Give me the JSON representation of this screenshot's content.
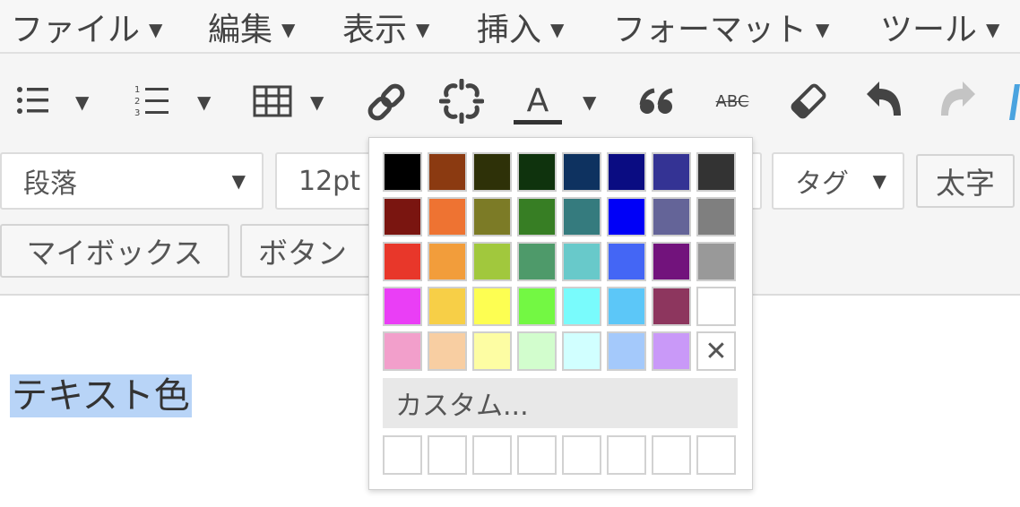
{
  "menubar": {
    "items": [
      {
        "label": "ファイル",
        "caret": "▼"
      },
      {
        "label": "編集",
        "caret": "▼"
      },
      {
        "label": "表示",
        "caret": "▼"
      },
      {
        "label": "挿入",
        "caret": "▼"
      },
      {
        "label": "フォーマット",
        "caret": "▼"
      },
      {
        "label": "ツール",
        "caret": "▼"
      }
    ]
  },
  "toolbar1": {
    "icons": [
      "bullet-list-icon",
      "numbered-list-icon",
      "table-icon",
      "link-icon",
      "unlink-icon",
      "text-color-icon",
      "blockquote-icon",
      "strikethrough-icon",
      "eraser-icon",
      "undo-icon",
      "redo-icon"
    ],
    "text_color_letter": "A",
    "strikethrough_text": "ABC",
    "caret": "▼"
  },
  "toolbar2": {
    "format_select": "段落",
    "font_size_select": "12pt",
    "tag_button": "タグ",
    "bold_button": "太字",
    "caret": "▼"
  },
  "toolbar3": {
    "mybox_button": "マイボックス",
    "button_button": "ボタン"
  },
  "content": {
    "selected_text": "テキスト色"
  },
  "color_picker": {
    "swatches": [
      [
        "#000000",
        "#8B3A11",
        "#2E3108",
        "#0F330D",
        "#0E3260",
        "#0A0C82",
        "#343394",
        "#333333"
      ],
      [
        "#7A1510",
        "#EE7332",
        "#7C7B26",
        "#377E24",
        "#357B7E",
        "#0000F7",
        "#646498",
        "#7F7F7F"
      ],
      [
        "#E8372A",
        "#F29D3B",
        "#A1C83D",
        "#4E9A6A",
        "#68C9CA",
        "#4466F5",
        "#72137C",
        "#999999"
      ],
      [
        "#EA3EF6",
        "#F7CF47",
        "#FDFE52",
        "#73F843",
        "#79FBFC",
        "#5CC7F8",
        "#8D365E",
        "#FFFFFF"
      ],
      [
        "#F29FCB",
        "#F8CEA2",
        "#FDFDA3",
        "#D2FDCD",
        "#D1FFFF",
        "#A4C9FB",
        "#C999F8",
        "remove"
      ]
    ],
    "remove_symbol": "✕",
    "custom_label": "カスタム...",
    "custom_slot_count": 8
  }
}
